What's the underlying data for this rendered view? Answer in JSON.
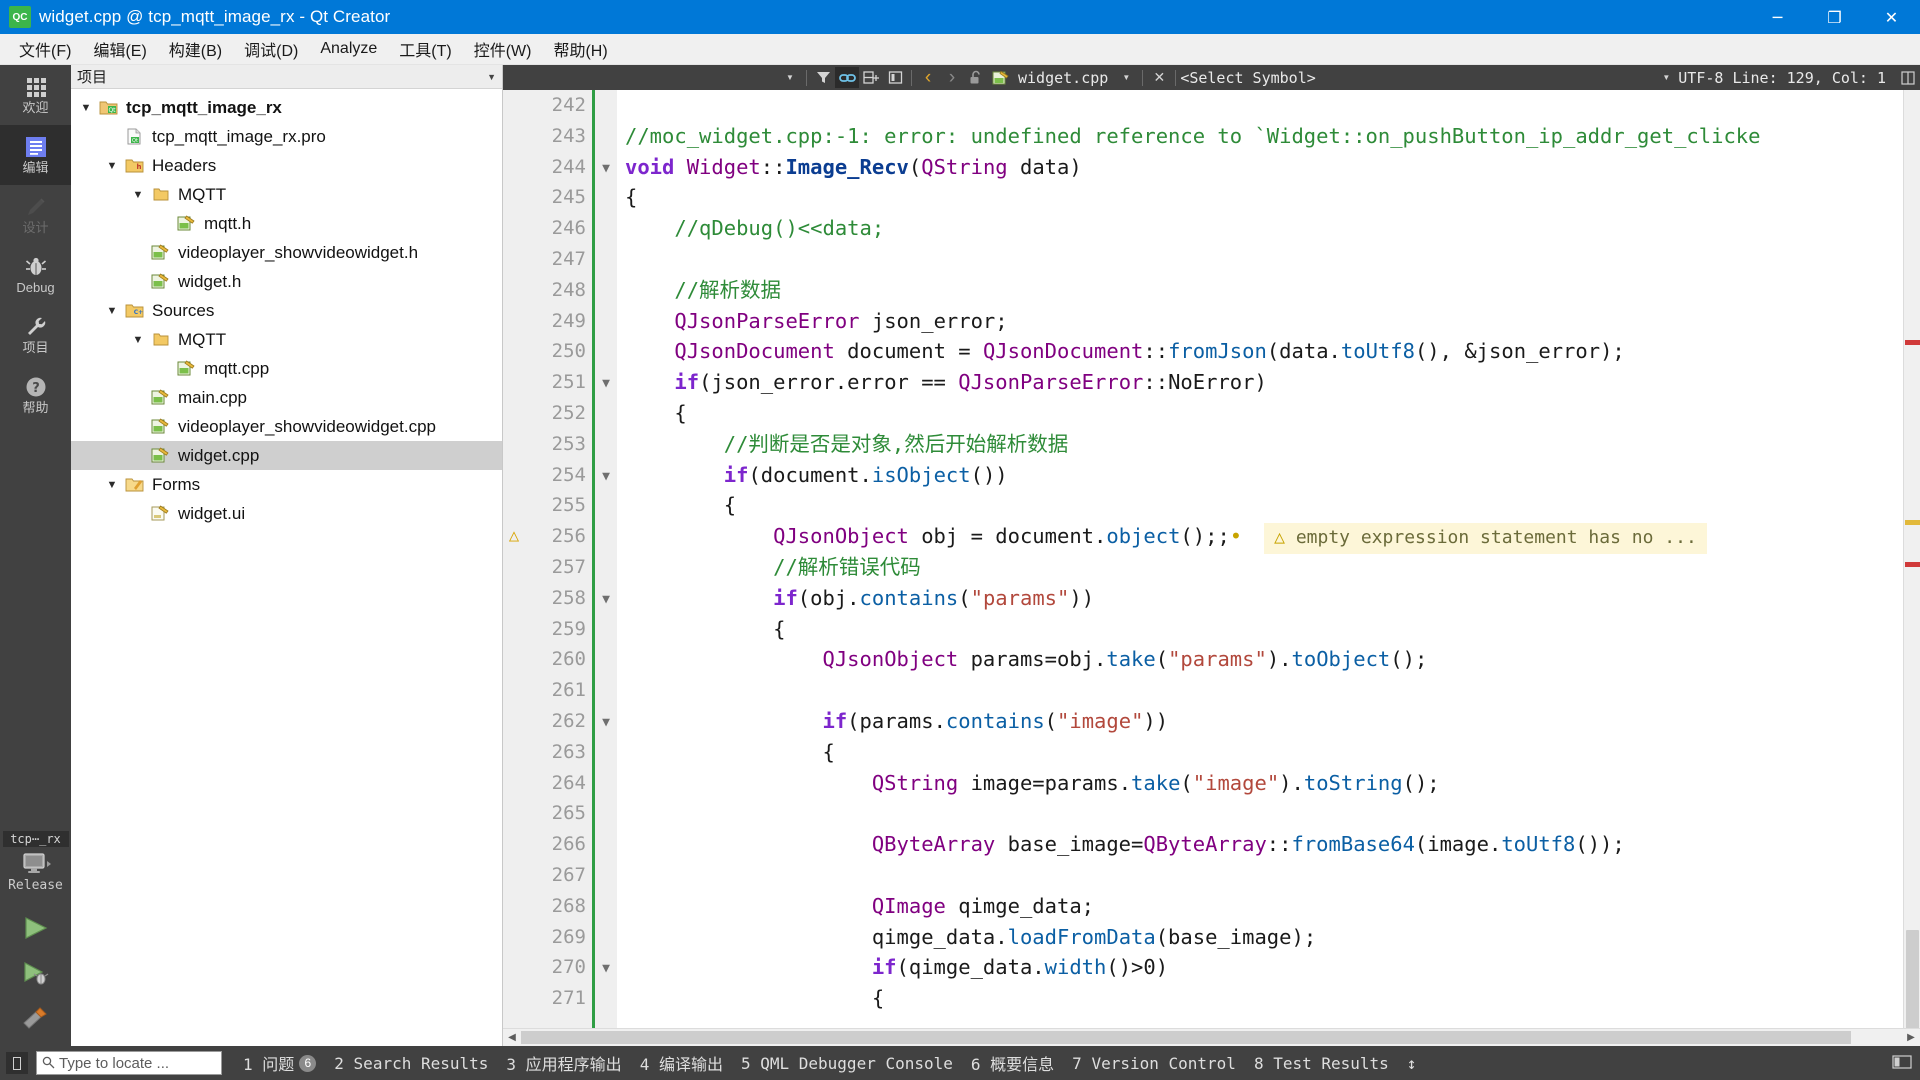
{
  "window": {
    "title": "widget.cpp @ tcp_mqtt_image_rx - Qt Creator",
    "app_icon_text": "QC",
    "minimize": "─",
    "maximize": "❐",
    "close": "✕"
  },
  "menubar": {
    "items": [
      {
        "label": "文件(F)"
      },
      {
        "label": "编辑(E)"
      },
      {
        "label": "构建(B)"
      },
      {
        "label": "调试(D)"
      },
      {
        "label": "Analyze"
      },
      {
        "label": "工具(T)"
      },
      {
        "label": "控件(W)"
      },
      {
        "label": "帮助(H)"
      }
    ]
  },
  "modebar": {
    "modes": [
      {
        "label": "欢迎",
        "icon": "grid-icon",
        "state": "normal"
      },
      {
        "label": "编辑",
        "icon": "document-icon",
        "state": "active"
      },
      {
        "label": "设计",
        "icon": "pencil-icon",
        "state": "disabled"
      },
      {
        "label": "Debug",
        "icon": "bug-icon",
        "state": "normal"
      },
      {
        "label": "项目",
        "icon": "wrench-icon",
        "state": "normal"
      },
      {
        "label": "帮助",
        "icon": "question-icon",
        "state": "normal"
      }
    ],
    "kit": {
      "project_name": "tcp⋯_rx",
      "target_icon": "desktop-icon",
      "build_config": "Release"
    },
    "run_buttons": [
      {
        "name": "run-button",
        "icon": "play-icon"
      },
      {
        "name": "debug-button",
        "icon": "play-bug-icon"
      },
      {
        "name": "build-button",
        "icon": "hammer-icon"
      }
    ]
  },
  "sidebar": {
    "header_title": "项目",
    "header_dropdown_icon": "chevron-down-icon",
    "tree": [
      {
        "label": "tcp_mqtt_image_rx",
        "depth": 0,
        "arrow": "down",
        "icon": "qt-project-icon",
        "bold": true,
        "selected": false
      },
      {
        "label": "tcp_mqtt_image_rx.pro",
        "depth": 1,
        "arrow": "none",
        "icon": "pro-file-icon",
        "bold": false,
        "selected": false
      },
      {
        "label": "Headers",
        "depth": 1,
        "arrow": "down",
        "icon": "folder-h-icon",
        "bold": false,
        "selected": false
      },
      {
        "label": "MQTT",
        "depth": 2,
        "arrow": "down",
        "icon": "folder-icon",
        "bold": false,
        "selected": false
      },
      {
        "label": "mqtt.h",
        "depth": 3,
        "arrow": "none",
        "icon": "source-file-icon",
        "bold": false,
        "selected": false
      },
      {
        "label": "videoplayer_showvideowidget.h",
        "depth": 2,
        "arrow": "none",
        "icon": "source-file-icon",
        "bold": false,
        "selected": false
      },
      {
        "label": "widget.h",
        "depth": 2,
        "arrow": "none",
        "icon": "source-file-icon",
        "bold": false,
        "selected": false
      },
      {
        "label": "Sources",
        "depth": 1,
        "arrow": "down",
        "icon": "folder-cpp-icon",
        "bold": false,
        "selected": false
      },
      {
        "label": "MQTT",
        "depth": 2,
        "arrow": "down",
        "icon": "folder-icon",
        "bold": false,
        "selected": false
      },
      {
        "label": "mqtt.cpp",
        "depth": 3,
        "arrow": "none",
        "icon": "source-file-icon",
        "bold": false,
        "selected": false
      },
      {
        "label": "main.cpp",
        "depth": 2,
        "arrow": "none",
        "icon": "source-file-icon",
        "bold": false,
        "selected": false
      },
      {
        "label": "videoplayer_showvideowidget.cpp",
        "depth": 2,
        "arrow": "none",
        "icon": "source-file-icon",
        "bold": false,
        "selected": false
      },
      {
        "label": "widget.cpp",
        "depth": 2,
        "arrow": "none",
        "icon": "source-file-icon",
        "bold": false,
        "selected": true
      },
      {
        "label": "Forms",
        "depth": 1,
        "arrow": "down",
        "icon": "folder-ui-icon",
        "bold": false,
        "selected": false
      },
      {
        "label": "widget.ui",
        "depth": 2,
        "arrow": "none",
        "icon": "ui-file-icon",
        "bold": false,
        "selected": false
      }
    ]
  },
  "editor_toolbar": {
    "filter_dropdown_icon": "chevron-down-icon",
    "filter_icon": "filter-icon",
    "link_icon": "link-icon",
    "split_icon": "split-icon",
    "unsplit_icon": "unsplit-icon",
    "back_icon": "‹",
    "forward_icon": "›",
    "lock_icon": "unlock-icon",
    "file_icon": "source-file-icon",
    "file_name": "widget.cpp",
    "file_dropdown_icon": "chevron-down-icon",
    "close_icon": "✕",
    "symbol_selector": "<Select Symbol>",
    "symbol_dropdown_icon": "chevron-down-icon",
    "encoding": "UTF-8",
    "line_label": "Line:",
    "line_value": "129",
    "col_label": "Col:",
    "col_value": "1",
    "split_right_icon": "split-h-icon"
  },
  "editor": {
    "first_line_number": 242,
    "warning_line": 256,
    "warning_text": "empty expression statement has no ...",
    "warning_icon": "⚠",
    "fold_lines": [
      244,
      251,
      254,
      258,
      262,
      270
    ],
    "lines": [
      {
        "n": 242,
        "tokens": []
      },
      {
        "n": 243,
        "tokens": [
          {
            "t": "//moc_widget.cpp:-1: error: undefined reference to `Widget::on_pushButton_ip_addr_get_clicke",
            "c": "cmt"
          }
        ]
      },
      {
        "n": 244,
        "tokens": [
          {
            "t": "void ",
            "c": "kw"
          },
          {
            "t": "Widget",
            "c": "typ"
          },
          {
            "t": "::",
            "c": "op"
          },
          {
            "t": "Image_Recv",
            "c": "fnd"
          },
          {
            "t": "(",
            "c": "op"
          },
          {
            "t": "QString",
            "c": "typ"
          },
          {
            "t": " data)",
            "c": "op"
          }
        ]
      },
      {
        "n": 245,
        "tokens": [
          {
            "t": "{",
            "c": "op"
          }
        ]
      },
      {
        "n": 246,
        "tokens": [
          {
            "t": "    //qDebug()<<data;",
            "c": "cmt"
          }
        ]
      },
      {
        "n": 247,
        "tokens": []
      },
      {
        "n": 248,
        "tokens": [
          {
            "t": "    //解析数据",
            "c": "cmt"
          }
        ]
      },
      {
        "n": 249,
        "tokens": [
          {
            "t": "    ",
            "c": "op"
          },
          {
            "t": "QJsonParseError",
            "c": "typ"
          },
          {
            "t": " json_error;",
            "c": "op"
          }
        ]
      },
      {
        "n": 250,
        "tokens": [
          {
            "t": "    ",
            "c": "op"
          },
          {
            "t": "QJsonDocument",
            "c": "typ"
          },
          {
            "t": " document = ",
            "c": "op"
          },
          {
            "t": "QJsonDocument",
            "c": "typ"
          },
          {
            "t": "::",
            "c": "op"
          },
          {
            "t": "fromJson",
            "c": "fn"
          },
          {
            "t": "(data.",
            "c": "op"
          },
          {
            "t": "toUtf8",
            "c": "fn"
          },
          {
            "t": "(), &json_error);",
            "c": "op"
          }
        ]
      },
      {
        "n": 251,
        "tokens": [
          {
            "t": "    ",
            "c": "op"
          },
          {
            "t": "if",
            "c": "kw"
          },
          {
            "t": "(json_error.error == ",
            "c": "op"
          },
          {
            "t": "QJsonParseError",
            "c": "typ"
          },
          {
            "t": "::NoError)",
            "c": "op"
          }
        ]
      },
      {
        "n": 252,
        "tokens": [
          {
            "t": "    {",
            "c": "op"
          }
        ]
      },
      {
        "n": 253,
        "tokens": [
          {
            "t": "        //判断是否是对象,然后开始解析数据",
            "c": "cmt"
          }
        ]
      },
      {
        "n": 254,
        "tokens": [
          {
            "t": "        ",
            "c": "op"
          },
          {
            "t": "if",
            "c": "kw"
          },
          {
            "t": "(document.",
            "c": "op"
          },
          {
            "t": "isObject",
            "c": "fn"
          },
          {
            "t": "())",
            "c": "op"
          }
        ]
      },
      {
        "n": 255,
        "tokens": [
          {
            "t": "        {",
            "c": "op"
          }
        ]
      },
      {
        "n": 256,
        "tokens": [
          {
            "t": "            ",
            "c": "op"
          },
          {
            "t": "QJsonObject",
            "c": "typ"
          },
          {
            "t": " obj = document.",
            "c": "op"
          },
          {
            "t": "object",
            "c": "fn"
          },
          {
            "t": "();;",
            "c": "op"
          }
        ]
      },
      {
        "n": 257,
        "tokens": [
          {
            "t": "            //解析错误代码",
            "c": "cmt"
          }
        ]
      },
      {
        "n": 258,
        "tokens": [
          {
            "t": "            ",
            "c": "op"
          },
          {
            "t": "if",
            "c": "kw"
          },
          {
            "t": "(obj.",
            "c": "op"
          },
          {
            "t": "contains",
            "c": "fn"
          },
          {
            "t": "(",
            "c": "op"
          },
          {
            "t": "\"params\"",
            "c": "str"
          },
          {
            "t": "))",
            "c": "op"
          }
        ]
      },
      {
        "n": 259,
        "tokens": [
          {
            "t": "            {",
            "c": "op"
          }
        ]
      },
      {
        "n": 260,
        "tokens": [
          {
            "t": "                ",
            "c": "op"
          },
          {
            "t": "QJsonObject",
            "c": "typ"
          },
          {
            "t": " params=obj.",
            "c": "op"
          },
          {
            "t": "take",
            "c": "fn"
          },
          {
            "t": "(",
            "c": "op"
          },
          {
            "t": "\"params\"",
            "c": "str"
          },
          {
            "t": ").",
            "c": "op"
          },
          {
            "t": "toObject",
            "c": "fn"
          },
          {
            "t": "();",
            "c": "op"
          }
        ]
      },
      {
        "n": 261,
        "tokens": []
      },
      {
        "n": 262,
        "tokens": [
          {
            "t": "                ",
            "c": "op"
          },
          {
            "t": "if",
            "c": "kw"
          },
          {
            "t": "(params.",
            "c": "op"
          },
          {
            "t": "contains",
            "c": "fn"
          },
          {
            "t": "(",
            "c": "op"
          },
          {
            "t": "\"image\"",
            "c": "str"
          },
          {
            "t": "))",
            "c": "op"
          }
        ]
      },
      {
        "n": 263,
        "tokens": [
          {
            "t": "                {",
            "c": "op"
          }
        ]
      },
      {
        "n": 264,
        "tokens": [
          {
            "t": "                    ",
            "c": "op"
          },
          {
            "t": "QString",
            "c": "typ"
          },
          {
            "t": " image=params.",
            "c": "op"
          },
          {
            "t": "take",
            "c": "fn"
          },
          {
            "t": "(",
            "c": "op"
          },
          {
            "t": "\"image\"",
            "c": "str"
          },
          {
            "t": ").",
            "c": "op"
          },
          {
            "t": "toString",
            "c": "fn"
          },
          {
            "t": "();",
            "c": "op"
          }
        ]
      },
      {
        "n": 265,
        "tokens": []
      },
      {
        "n": 266,
        "tokens": [
          {
            "t": "                    ",
            "c": "op"
          },
          {
            "t": "QByteArray",
            "c": "typ"
          },
          {
            "t": " base_image=",
            "c": "op"
          },
          {
            "t": "QByteArray",
            "c": "typ"
          },
          {
            "t": "::",
            "c": "op"
          },
          {
            "t": "fromBase64",
            "c": "fn"
          },
          {
            "t": "(image.",
            "c": "op"
          },
          {
            "t": "toUtf8",
            "c": "fn"
          },
          {
            "t": "());",
            "c": "op"
          }
        ]
      },
      {
        "n": 267,
        "tokens": []
      },
      {
        "n": 268,
        "tokens": [
          {
            "t": "                    ",
            "c": "op"
          },
          {
            "t": "QImage",
            "c": "typ"
          },
          {
            "t": " qimge_data;",
            "c": "op"
          }
        ]
      },
      {
        "n": 269,
        "tokens": [
          {
            "t": "                    qimge_data.",
            "c": "op"
          },
          {
            "t": "loadFromData",
            "c": "fn"
          },
          {
            "t": "(base_image);",
            "c": "op"
          }
        ]
      },
      {
        "n": 270,
        "tokens": [
          {
            "t": "                    ",
            "c": "op"
          },
          {
            "t": "if",
            "c": "kw"
          },
          {
            "t": "(qimge_data.",
            "c": "op"
          },
          {
            "t": "width",
            "c": "fn"
          },
          {
            "t": "()>",
            "c": "op"
          },
          {
            "t": "0",
            "c": "num"
          },
          {
            "t": ")",
            "c": "op"
          }
        ]
      },
      {
        "n": 271,
        "tokens": [
          {
            "t": "                    {",
            "c": "op"
          }
        ]
      }
    ]
  },
  "statusbar": {
    "toggle_sidebar_icon": "panel-toggle-icon",
    "locator_icon": "search-icon",
    "locator_placeholder": "Type to locate ...",
    "panes": [
      {
        "num": "1",
        "label": "问题",
        "badge": "6"
      },
      {
        "num": "2",
        "label": "Search Results",
        "badge": ""
      },
      {
        "num": "3",
        "label": "应用程序输出",
        "badge": ""
      },
      {
        "num": "4",
        "label": "编译输出",
        "badge": ""
      },
      {
        "num": "5",
        "label": "QML Debugger Console",
        "badge": ""
      },
      {
        "num": "6",
        "label": "概要信息",
        "badge": ""
      },
      {
        "num": "7",
        "label": "Version Control",
        "badge": ""
      },
      {
        "num": "8",
        "label": "Test Results",
        "badge": ""
      }
    ],
    "updown_icon": "↕",
    "right_icon": "expand-icon"
  },
  "colors": {
    "titlebar": "#0078d7",
    "modebar": "#414141",
    "accent_green": "#2f9e44",
    "warning_bg": "#fdf6d8",
    "selection": "#cfcfcf"
  }
}
